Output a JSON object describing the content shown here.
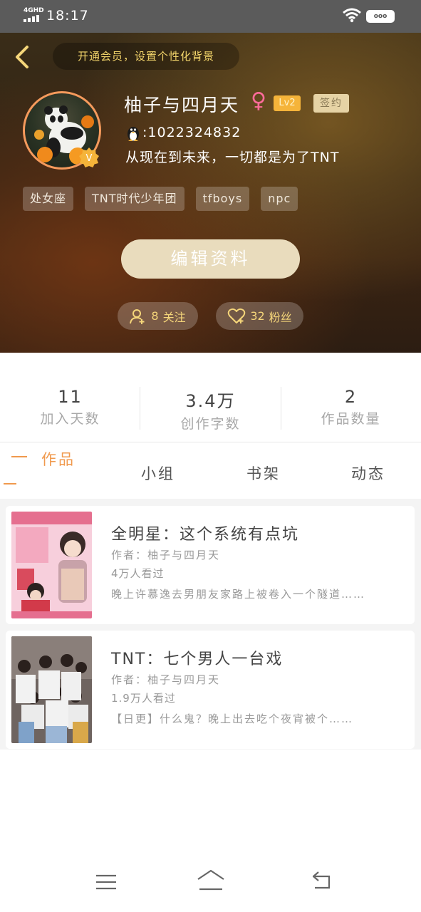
{
  "status_bar": {
    "network": "4GHD",
    "time": "18:17",
    "battery_label": "ooo"
  },
  "header": {
    "vip_prompt": "开通会员，设置个性化背景",
    "username": "柚子与四月天",
    "gender_symbol": "♀",
    "level": "Lv2",
    "signed_badge": "签约",
    "qq": ":1022324832",
    "bio": "从现在到未来，一切都是为了TNT",
    "tags": [
      "处女座",
      "TNT时代少年团",
      "tfboys",
      "npc"
    ],
    "edit_button": "编辑资料",
    "following_count": "8",
    "following_label": "关注",
    "fans_count": "32",
    "fans_label": "粉丝"
  },
  "stats": [
    {
      "value": "11",
      "label": "加入天数"
    },
    {
      "value": "3.4万",
      "label": "创作字数"
    },
    {
      "value": "2",
      "label": "作品数量"
    }
  ],
  "tabs": [
    {
      "label": "作品",
      "active": true
    },
    {
      "label": "小组",
      "active": false
    },
    {
      "label": "书架",
      "active": false
    },
    {
      "label": "动态",
      "active": false
    }
  ],
  "works": [
    {
      "title": "全明星：这个系统有点坑",
      "author": "作者：柚子与四月天",
      "views": "4万人看过",
      "description": "晚上许慕逸去男朋友家路上被卷入一个隧道……"
    },
    {
      "title": "TNT：七个男人一台戏",
      "author": "作者：柚子与四月天",
      "views": "1.9万人看过",
      "description": "【日更】什么鬼？晚上出去吃个夜宵被个……"
    }
  ],
  "colors": {
    "accent": "#f0994d",
    "gold": "#f5d67a",
    "edit_button": "#e9dcbd"
  }
}
